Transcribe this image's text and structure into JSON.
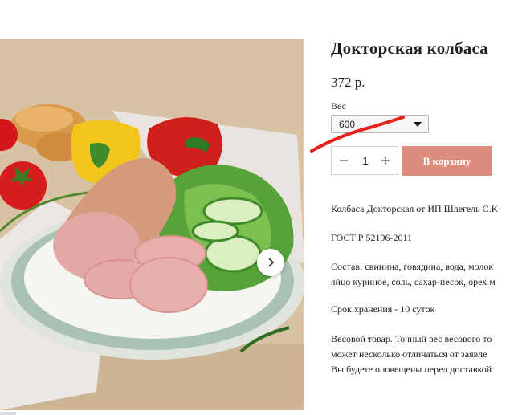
{
  "product": {
    "title": "Докторская колбаса",
    "price": "372 р.",
    "weight_label": "Вес",
    "weight_value": "600",
    "quantity": "1",
    "cart_button": "В корзину"
  },
  "description": {
    "line1": "Колбаса Докторская от ИП Шлегель С.К",
    "gost": "ГОСТ Р 52196-2011",
    "composition_1": "Состав: свинина, говядина, вода, молок",
    "composition_2": "яйцо куриное, соль, сахар-песок, орех м",
    "shelf_life": "Срок хранения - 10 суток",
    "weight_note_1": "Весовой товар. Точный вес весового то",
    "weight_note_2": "может несколько отличаться от заявле",
    "weight_note_3": "Вы будете оповещены перед доставкой"
  },
  "icons": {
    "gallery_next": "chevron-right-icon",
    "dropdown": "caret-down-icon",
    "minus": "minus-icon",
    "plus": "plus-icon"
  },
  "colors": {
    "cart_button": "#dc8c7d",
    "annotation": "#e8231b"
  }
}
